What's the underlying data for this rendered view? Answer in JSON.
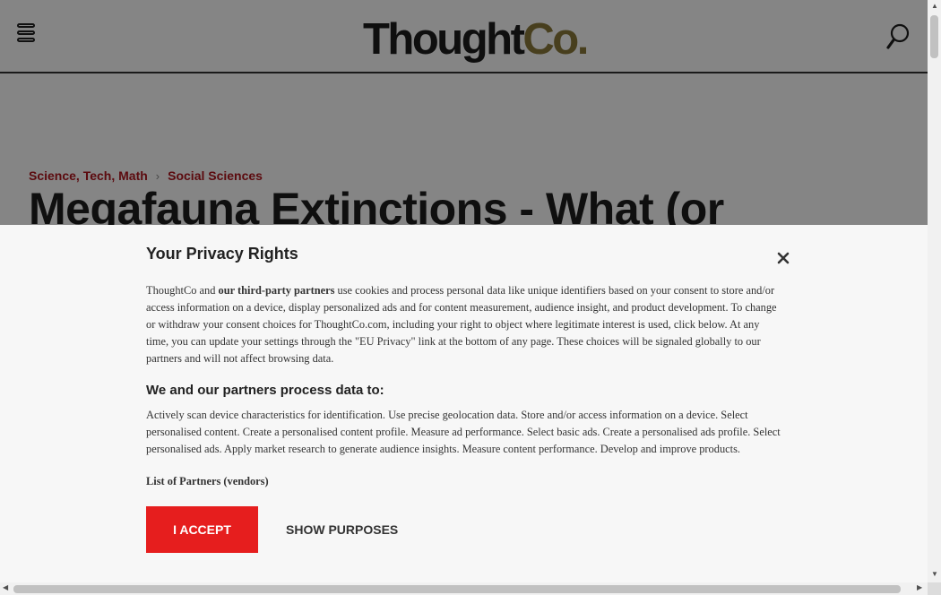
{
  "header": {
    "logo_part1": "Thought",
    "logo_part2": "Co.",
    "logo_accent_color": "#8a7a3a"
  },
  "breadcrumb": {
    "items": [
      "Science, Tech, Math",
      "Social Sciences"
    ],
    "separator": "›"
  },
  "article": {
    "title": "Megafauna Extinctions - What (or"
  },
  "consent": {
    "title": "Your Privacy Rights",
    "intro_lead": "ThoughtCo and ",
    "intro_link": "our third-party partners",
    "intro_rest": " use cookies and process personal data like unique identifiers based on your consent to store and/or access information on a device, display personalized ads and for content measurement, audience insight, and product development. To change or withdraw your consent choices for ThoughtCo.com, including your right to object where legitimate interest is used, click below. At any time, you can update your settings through the \"EU Privacy\" link at the bottom of any page. These choices will be signaled globally to our partners and will not affect browsing data.",
    "subheading": "We and our partners process data to:",
    "purposes": "Actively scan device characteristics for identification. Use precise geolocation data. Store and/or access information on a device. Select personalised content. Create a personalised content profile. Measure ad performance. Select basic ads. Create a personalised ads profile. Select personalised ads. Apply market research to generate audience insights. Measure content performance. Develop and improve products.",
    "partners_link": "List of Partners (vendors)",
    "accept_label": "I ACCEPT",
    "show_purposes_label": "SHOW PURPOSES",
    "accent_color": "#e61e1e"
  },
  "icons": {
    "menu": "menu-icon",
    "search": "search-icon",
    "close": "close-icon"
  }
}
